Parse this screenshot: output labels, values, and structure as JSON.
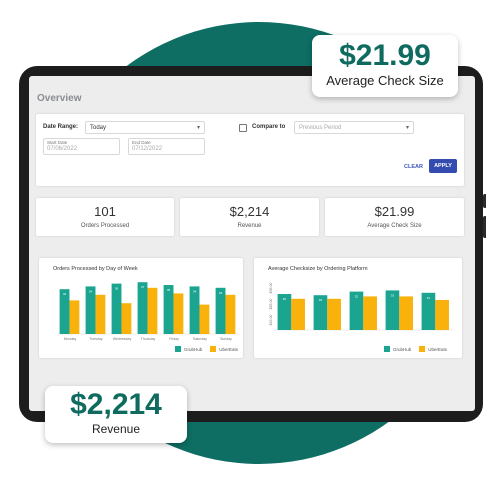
{
  "overview": {
    "title": "Overview",
    "date_range_label": "Date Range:",
    "date_range_value": "Today",
    "compare_label": "Compare to",
    "compare_value": "Previous Period",
    "start_date_label": "Start Date",
    "start_date_value": "07/06/2022",
    "end_date_label": "End Date",
    "end_date_value": "07/12/2022",
    "clear_label": "CLEAR",
    "apply_label": "APPLY"
  },
  "kpis": [
    {
      "value": "101",
      "label": "Orders Processed"
    },
    {
      "value": "$2,214",
      "label": "Revenue"
    },
    {
      "value": "$21.99",
      "label": "Average Check Size"
    }
  ],
  "callouts": {
    "check": {
      "value": "$21.99",
      "label": "Average Check Size"
    },
    "revenue": {
      "value": "$2,214",
      "label": "Revenue"
    }
  },
  "colors": {
    "teal": "#1ba591",
    "orange": "#f9b20b",
    "brand": "#0e6e63",
    "apply": "#344bb0"
  },
  "chart_data": [
    {
      "type": "bar",
      "title": "Orders Processed by Day of Week",
      "categories": [
        "Monday",
        "Tuesday",
        "Wednesday",
        "Thursday",
        "Friday",
        "Saturday",
        "Sunday"
      ],
      "ylim": [
        0,
        40
      ],
      "series": [
        {
          "name": "GrubHub",
          "values": [
            32,
            34,
            36,
            37,
            35,
            34,
            33
          ]
        },
        {
          "name": "UberEats",
          "values": [
            24,
            28,
            22,
            33,
            29,
            21,
            28
          ]
        }
      ]
    },
    {
      "type": "bar",
      "title": "Average Checksize by Ordering Platform",
      "categories": [
        "",
        "",
        "",
        "",
        ""
      ],
      "yticks": [
        "$35.00",
        "$25.00",
        "$15.00"
      ],
      "ylim": [
        0,
        40
      ],
      "series": [
        {
          "name": "GrubHub",
          "values": [
            30,
            29,
            32,
            33,
            31
          ]
        },
        {
          "name": "UberEats",
          "values": [
            26,
            26,
            28,
            28,
            25
          ]
        }
      ]
    }
  ]
}
